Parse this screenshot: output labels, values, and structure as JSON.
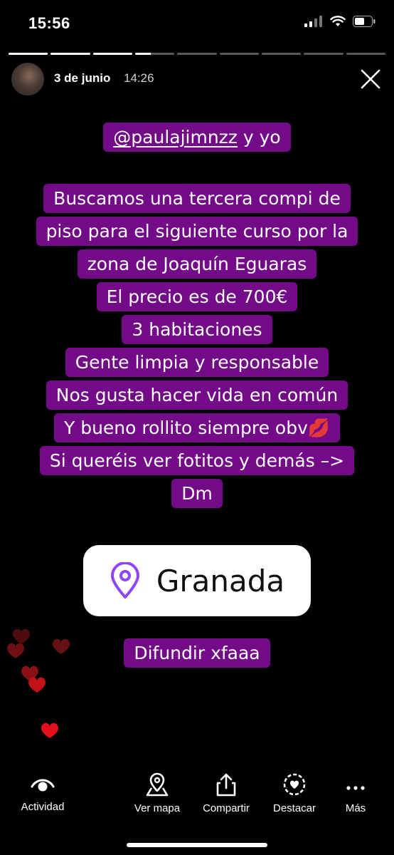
{
  "status_bar": {
    "time": "15:56"
  },
  "progress": {
    "segments": [
      1,
      1,
      1,
      0.4,
      0,
      0,
      0,
      0,
      0
    ]
  },
  "header": {
    "date": "3 de junio",
    "time": "14:26"
  },
  "story": {
    "mention": "@paulajimnzz",
    "mention_suffix": " y yo",
    "lines": [
      "Buscamos una tercera compi de",
      "piso para el siguiente curso por la",
      "zona de Joaquín Eguaras",
      "El precio es de 700€",
      "3 habitaciones",
      "Gente limpia y responsable",
      "Nos gusta hacer vida en común",
      "Y bueno rollito siempre obv💋",
      "Si queréis ver fotitos y demás –>",
      "Dm"
    ],
    "location_sticker": {
      "label": "Granada",
      "icon": "location-pin-icon",
      "icon_color": "#8e44f0"
    },
    "closing": "Difundir xfaaa",
    "highlight_color": "#730a88"
  },
  "bottom_bar": {
    "items": [
      {
        "label": "Actividad",
        "icon": "eye-icon"
      },
      {
        "label": "Ver mapa",
        "icon": "map-pin-icon"
      },
      {
        "label": "Compartir",
        "icon": "share-icon"
      },
      {
        "label": "Destacar",
        "icon": "highlight-heart-icon"
      },
      {
        "label": "Más",
        "icon": "more-icon"
      }
    ]
  }
}
